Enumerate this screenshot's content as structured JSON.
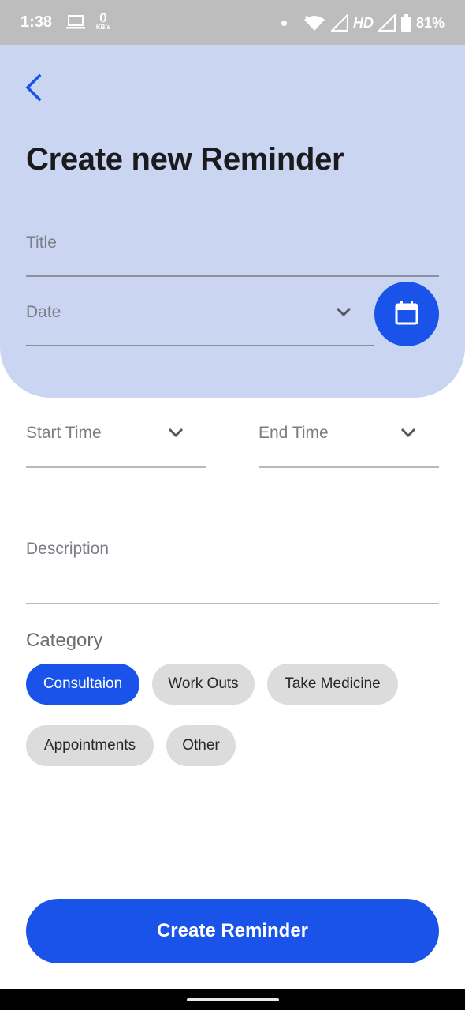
{
  "status_bar": {
    "time": "1:38",
    "net_speed_value": "0",
    "net_speed_unit": "KB/s",
    "network_label": "HD",
    "battery": "81%",
    "icons": [
      "laptop-icon",
      "notification-dot-icon",
      "wifi-icon",
      "signal-icon",
      "signal-icon",
      "battery-icon"
    ]
  },
  "header": {
    "back_icon": "chevron-left-icon",
    "title": "Create new Reminder"
  },
  "form": {
    "title_placeholder": "Title",
    "date_placeholder": "Date",
    "calendar_icon": "calendar-icon",
    "start_time_placeholder": "Start Time",
    "end_time_placeholder": "End Time",
    "description_placeholder": "Description",
    "category_label": "Category",
    "categories": [
      {
        "label": "Consultaion",
        "selected": true
      },
      {
        "label": "Work Outs",
        "selected": false
      },
      {
        "label": "Take Medicine",
        "selected": false
      },
      {
        "label": "Appointments",
        "selected": false
      },
      {
        "label": "Other",
        "selected": false
      }
    ],
    "submit_label": "Create Reminder"
  },
  "colors": {
    "accent": "#1a53ea",
    "header_bg": "#cad5f2",
    "chip_bg": "#dcdcdc",
    "status_bar_bg": "#bdbdbd"
  }
}
